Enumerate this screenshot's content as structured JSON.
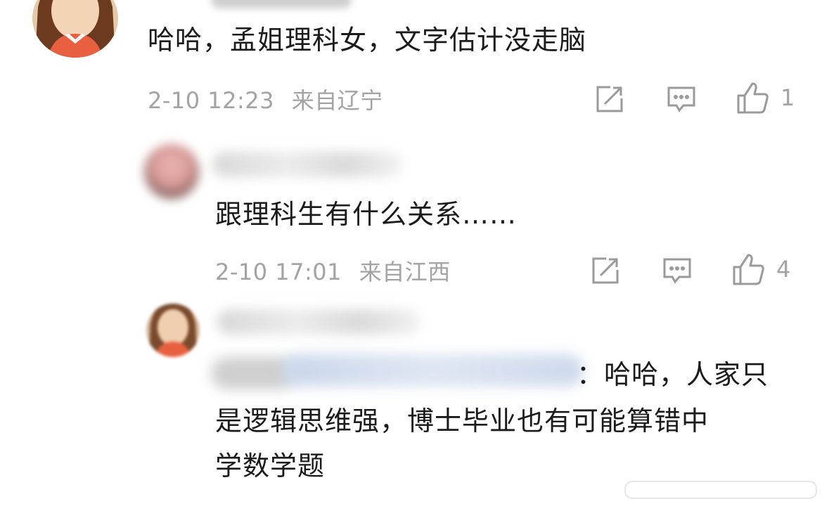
{
  "comments": [
    {
      "text": "哈哈，孟姐理科女，文字估计没走脑",
      "time": "2-10 12:23",
      "location": "来自辽宁",
      "likes": "1"
    },
    {
      "text": "跟理科生有什么关系……",
      "time": "2-10 17:01",
      "location": "来自江西",
      "likes": "4"
    },
    {
      "text_line1": "：哈哈，人家只",
      "text_line2": "是逻辑思维强，博士毕业也有可能算错中",
      "text_line3": "学数学题"
    }
  ],
  "icons": [
    "share-icon",
    "comment-icon",
    "like-icon"
  ],
  "colors": {
    "text": "#1b1b1b",
    "meta": "#a3a3a3",
    "icon": "#9a9a9a",
    "avatar_accent": "#e8603f"
  }
}
